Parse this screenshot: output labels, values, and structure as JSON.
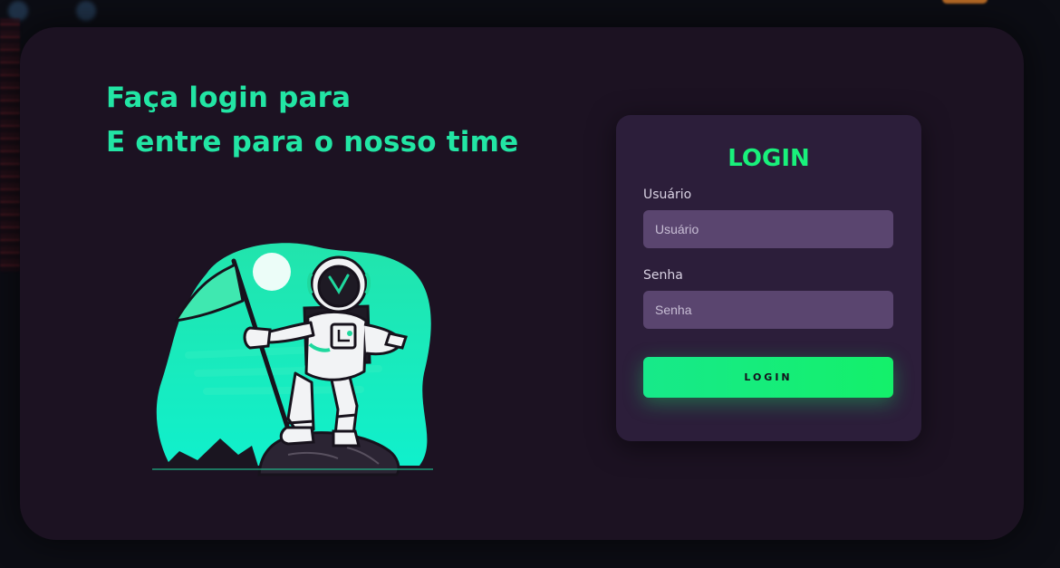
{
  "hero": {
    "line1": "Faça login para",
    "line2": "E entre para o nosso time"
  },
  "illustration": {
    "icon": "astronaut-with-flag-icon"
  },
  "login_card": {
    "title": "LOGIN",
    "username": {
      "label": "Usuário",
      "placeholder": "Usuário",
      "value": ""
    },
    "password": {
      "label": "Senha",
      "placeholder": "Senha",
      "value": ""
    },
    "submit_label": "LOGIN"
  },
  "colors": {
    "accent_text": "#22e5a4",
    "button": "#19f07b",
    "card": "#2c1e3a",
    "frame": "#1c1222",
    "input": "#5a456f"
  }
}
